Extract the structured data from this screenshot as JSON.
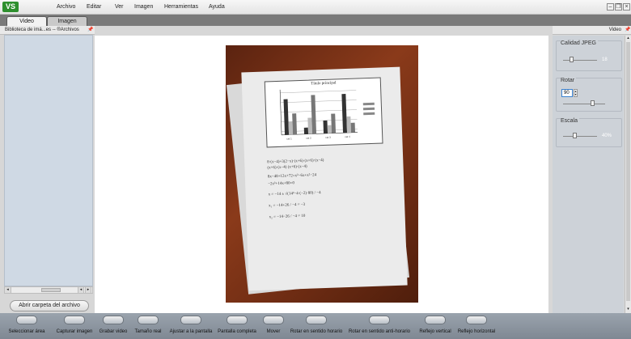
{
  "app": {
    "logo": "VS",
    "menu": [
      "Archivo",
      "Editar",
      "Ver",
      "Imagen",
      "Herramientas",
      "Ayuda"
    ]
  },
  "tabs": [
    {
      "label": "Video",
      "active": true
    },
    {
      "label": "Imagen",
      "active": false
    }
  ],
  "left_panel": {
    "title": "Biblioteca de imá...es -- ®Archivos",
    "open_folder_button": "Abrir carpeta del archivo"
  },
  "right_panel": {
    "title": "Video",
    "groups": [
      {
        "label": "Calidad JPEG",
        "slider_value": "18"
      },
      {
        "label": "Rotar",
        "input_value": "90"
      },
      {
        "label": "Escala",
        "slider_value": "40%"
      }
    ]
  },
  "document_preview": {
    "chart_title": "Título principal",
    "formulas": [
      "8·(x−4)+3(2−x)·(x+6)·(x+6)·(x−4)",
      "(x+6)·(x−4) (x+6)·(x−4)",
      "8x−48+12x+72=x²−6x+x²−24",
      "−2x²+14x+80=0",
      "x = −14 ± √(14²−4·(−2)·80) / −4",
      "x₁ = −14+26 / −4 = −3",
      "x₂ = −14−26 / −4 = 10"
    ]
  },
  "toolbar": [
    {
      "label": "Seleccionar área",
      "icon": "select-area-icon"
    },
    {
      "label": "Capturar imagen",
      "icon": "camera-icon"
    },
    {
      "label": "Grabar video",
      "icon": "record-icon"
    },
    {
      "label": "Tamaño real",
      "icon": "actual-size-icon"
    },
    {
      "label": "Ajustar a la pantalla",
      "icon": "fit-screen-icon"
    },
    {
      "label": "Pantalla completa",
      "icon": "fullscreen-icon"
    },
    {
      "label": "Mover",
      "icon": "move-icon"
    },
    {
      "label": "Rotar en sentido horario",
      "icon": "rotate-cw-icon"
    },
    {
      "label": "Rotar en sentido anti-horario",
      "icon": "rotate-ccw-icon"
    },
    {
      "label": "Reflejo vertical",
      "icon": "flip-vertical-icon"
    },
    {
      "label": "Reflejo horizontal",
      "icon": "flip-horizontal-icon"
    }
  ]
}
